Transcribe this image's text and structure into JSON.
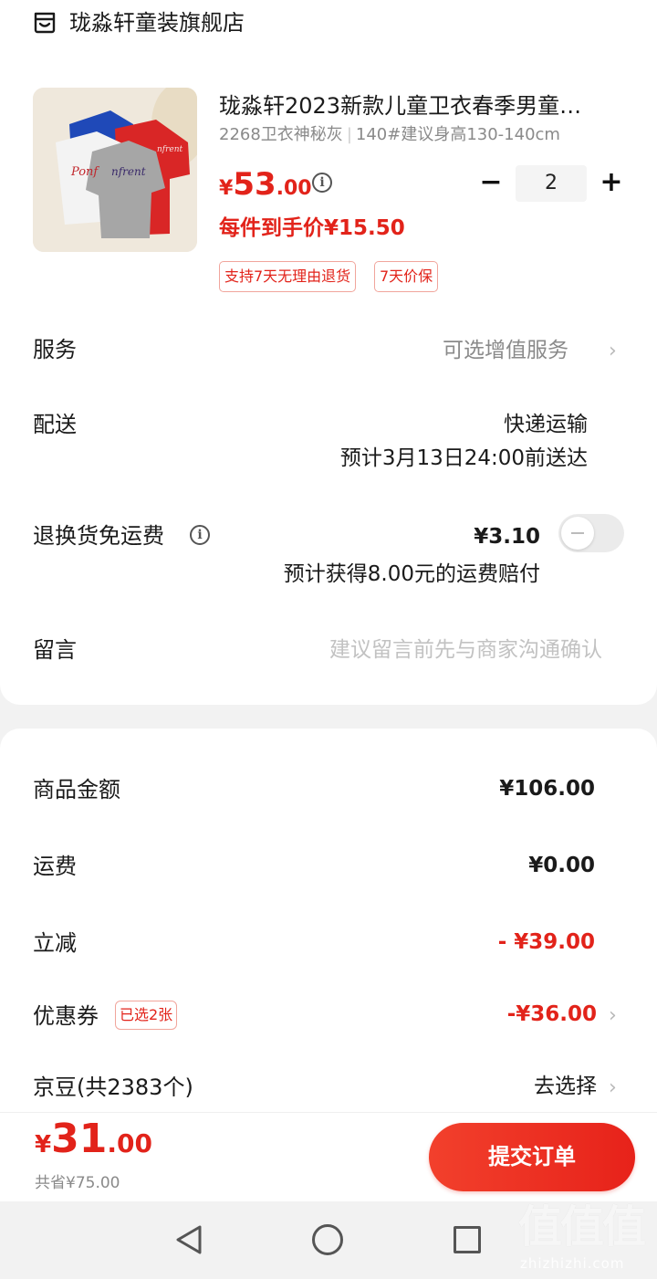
{
  "header": {
    "store_name": "珑淼轩童装旗舰店",
    "store_icon": "store-icon"
  },
  "product": {
    "title": "珑淼轩2023新款儿童卫衣春季男童…",
    "spec_color": "2268卫衣神秘灰",
    "spec_size": "140#建议身高130-140cm",
    "price_currency": "¥",
    "price_int": "53",
    "price_dec": ".00",
    "per_item_price": "每件到手价¥15.50",
    "tags": [
      "支持7天无理由退货",
      "7天价保"
    ],
    "quantity": "2",
    "qty_minus": "−",
    "qty_plus": "+"
  },
  "rows": {
    "service_label": "服务",
    "service_value": "可选增值服务",
    "delivery_label": "配送",
    "delivery_method": "快递运输",
    "delivery_eta": "预计3月13日24:00前送达",
    "return_label": "退换货免运费",
    "return_price": "¥3.10",
    "return_note": "预计获得8.00元的运费赔付",
    "return_toggle_on": false,
    "message_label": "留言",
    "message_placeholder": "建议留言前先与商家沟通确认"
  },
  "summary": {
    "goods_label": "商品金额",
    "goods_value": "¥106.00",
    "shipping_label": "运费",
    "shipping_value": "¥0.00",
    "discount_label": "立减",
    "discount_value": "- ¥39.00",
    "coupon_label": "优惠券",
    "coupon_badge": "已选2张",
    "coupon_value": "-¥36.00",
    "beans_label": "京豆(共2383个)",
    "beans_value": "去选择"
  },
  "footer": {
    "total_currency": "¥",
    "total_int": "31",
    "total_dec": ".00",
    "saved": "共省¥75.00",
    "submit_label": "提交订单"
  },
  "watermark": {
    "logo": "值值值",
    "domain": "zhizhizhi.com"
  },
  "colors": {
    "accent_red": "#e2231a",
    "gray_text": "#8a8a8a",
    "background": "#f2f2f2"
  }
}
